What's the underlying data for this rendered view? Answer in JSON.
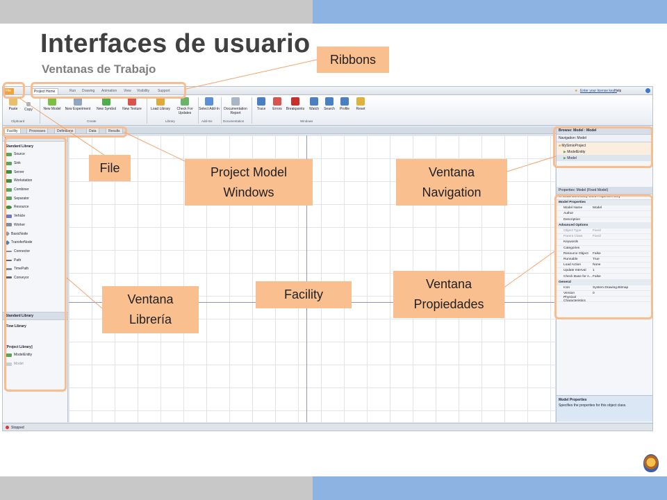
{
  "slide": {
    "title": "Interfaces de usuario",
    "subtitle": "Ventanas de Trabajo"
  },
  "colors": {
    "accent_orange": "#fabf8f",
    "band_blue": "#8db3e2",
    "band_gray": "#c8c8c8"
  },
  "app": {
    "file_tab": "File",
    "ribbon_tabs": [
      "Project Home",
      "Run",
      "Drawing",
      "Animation",
      "View",
      "Visibility",
      "Support"
    ],
    "license_link": "Enter your license key...",
    "help": "Help",
    "ribbon_buttons": [
      {
        "label": "Paste",
        "icon": "paste-icon"
      },
      {
        "label": "Copy",
        "icon": "copy-icon"
      },
      {
        "label": "New Model",
        "icon": "new-model-icon"
      },
      {
        "label": "New Experiment",
        "icon": "new-experiment-icon"
      },
      {
        "label": "New Symbol",
        "icon": "new-symbol-icon"
      },
      {
        "label": "New Texture",
        "icon": "new-texture-icon"
      },
      {
        "label": "Load Library",
        "icon": "load-library-icon"
      },
      {
        "label": "Check For Updates",
        "icon": "check-updates-icon"
      },
      {
        "label": "Select Add-In",
        "icon": "add-in-icon"
      },
      {
        "label": "Documentation Report",
        "icon": "report-icon"
      },
      {
        "label": "Trace",
        "icon": "trace-icon"
      },
      {
        "label": "Errors",
        "icon": "errors-icon"
      },
      {
        "label": "Breakpoints",
        "icon": "breakpoints-icon"
      },
      {
        "label": "Watch",
        "icon": "watch-icon"
      },
      {
        "label": "Search",
        "icon": "search-icon"
      },
      {
        "label": "Profile",
        "icon": "profile-icon"
      },
      {
        "label": "Reset",
        "icon": "reset-icon"
      }
    ],
    "ribbon_groups": [
      "Clipboard",
      "Create",
      "Library",
      "Add-Ins",
      "Documentation",
      "Windows"
    ],
    "doc_tabs": [
      "Facility",
      "Processes",
      "Definitions",
      "Data",
      "Results"
    ],
    "libraries": {
      "header": "Libraries",
      "section": "Standard Library",
      "items": [
        "Source",
        "Sink",
        "Server",
        "Workstation",
        "Combiner",
        "Separator",
        "Resource",
        "Vehicle",
        "Worker",
        "BasicNode",
        "TransferNode",
        "Connector",
        "Path",
        "TimePath",
        "Conveyor"
      ],
      "footer_items": [
        "Standard Library",
        "Flow Library"
      ],
      "project_library": "[Project Library]",
      "project_items": [
        "ModelEntity",
        "Model"
      ]
    },
    "navigation": {
      "header": "Browse: Model : Model",
      "subheader": "Navigation: Model",
      "items": [
        "MySimioProject",
        "ModelEntity",
        "Model"
      ]
    },
    "properties": {
      "header": "Properties: Model (Fixed Model)",
      "checkbox": "Show Commonly Used Properties Only",
      "rows": [
        {
          "k": "Model Properties",
          "v": "",
          "cat": true
        },
        {
          "k": "Model Name",
          "v": "Model"
        },
        {
          "k": "Author",
          "v": ""
        },
        {
          "k": "Description",
          "v": ""
        },
        {
          "k": "Advanced Options",
          "v": "",
          "cat": true
        },
        {
          "k": "Object Type",
          "v": "Fixed",
          "dim": true
        },
        {
          "k": "Parent Class",
          "v": "Fixed",
          "dim": true
        },
        {
          "k": "Keywords",
          "v": ""
        },
        {
          "k": "Categories",
          "v": ""
        },
        {
          "k": "Resource Object",
          "v": "False"
        },
        {
          "k": "Runnable",
          "v": "True"
        },
        {
          "k": "Load Action",
          "v": "None"
        },
        {
          "k": "Update Interval",
          "v": "1"
        },
        {
          "k": "Check Base for A...",
          "v": "False"
        },
        {
          "k": "General",
          "v": "",
          "cat": true
        },
        {
          "k": "Icon",
          "v": "System.Drawing.Bitmap"
        },
        {
          "k": "Version",
          "v": "0"
        },
        {
          "k": "Physical Characteristics",
          "v": ""
        }
      ],
      "desc_title": "Model Properties",
      "desc_text": "Specifies the properties for this object class."
    },
    "status": "Stopped"
  },
  "callouts": {
    "ribbons": "Ribbons",
    "file": "File",
    "project_model_windows": "Project Model Windows",
    "ventana_navigation": "Ventana Navigation",
    "ventana_libreria": "Ventana Librería",
    "facility": "Facility",
    "ventana_propiedades": "Ventana Propiedades"
  }
}
